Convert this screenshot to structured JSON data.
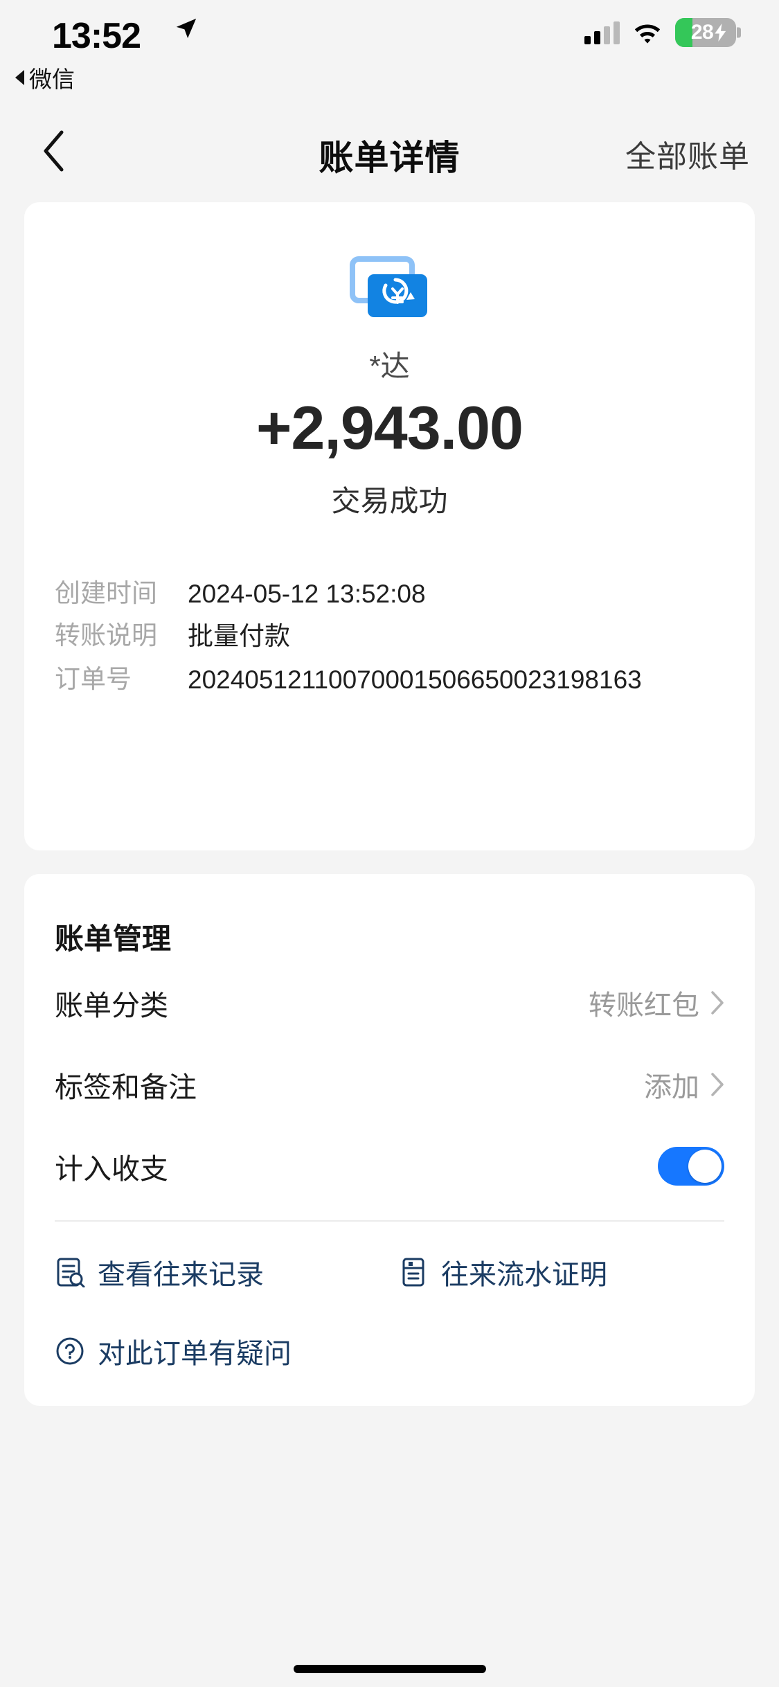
{
  "status_bar": {
    "time": "13:52",
    "location_icon": "location-arrow-icon",
    "signal_icon": "cellular-signal-icon",
    "wifi_icon": "wifi-icon",
    "battery_percent": "28",
    "battery_level": 28,
    "battery_charging": true,
    "battery_color": "#34c759"
  },
  "back_to_app": {
    "icon": "back-triangle-icon",
    "label": "微信"
  },
  "navbar": {
    "back_icon": "chevron-left-icon",
    "title": "账单详情",
    "right_action": "全部账单"
  },
  "transaction": {
    "icon": "transfer-cards-cny-icon",
    "counterparty": "*达",
    "amount": "+2,943.00",
    "status": "交易成功",
    "details": [
      {
        "label": "创建时间",
        "value": "2024-05-12 13:52:08"
      },
      {
        "label": "转账说明",
        "value": "批量付款"
      },
      {
        "label": "订单号",
        "value": "20240512110070001506650023198163"
      }
    ]
  },
  "manage": {
    "title": "账单管理",
    "rows": [
      {
        "label": "账单分类",
        "value": "转账红包",
        "chevron": "chevron-right-icon"
      },
      {
        "label": "标签和备注",
        "value": "添加",
        "chevron": "chevron-right-icon"
      }
    ],
    "toggle_row": {
      "label": "计入收支",
      "on": true,
      "accent": "#1677ff"
    },
    "actions": [
      {
        "label": "查看往来记录",
        "icon": "document-search-icon"
      },
      {
        "label": "往来流水证明",
        "icon": "document-statement-icon"
      },
      {
        "label": "对此订单有疑问",
        "icon": "question-circle-icon"
      }
    ],
    "link_color": "#1b3c63"
  }
}
